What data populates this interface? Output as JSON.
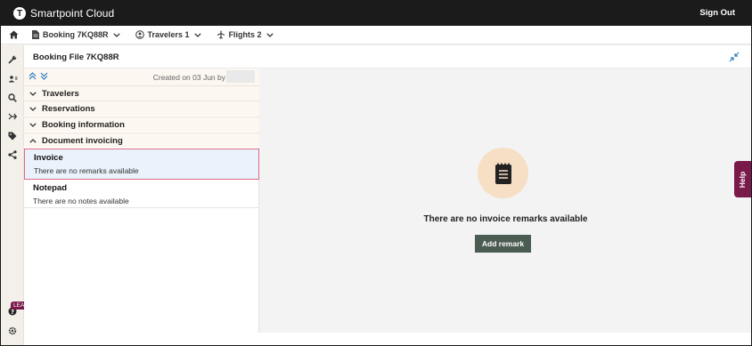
{
  "app": {
    "logo_letter": "T",
    "title": "Smartpoint Cloud",
    "sign_out": "Sign Out"
  },
  "nav": {
    "booking": "Booking 7KQ88R",
    "travelers": "Travelers 1",
    "flights": "Flights 2"
  },
  "sidebar": {
    "learn_badge": "LEARN"
  },
  "header": {
    "title": "Booking File 7KQ88R"
  },
  "left_panel": {
    "created": "Created on 03 Jun by",
    "sections": [
      {
        "label": "Travelers",
        "expanded": false
      },
      {
        "label": "Reservations",
        "expanded": false
      },
      {
        "label": "Booking information",
        "expanded": false
      },
      {
        "label": "Document invoicing",
        "expanded": true
      }
    ],
    "invoice": {
      "title": "Invoice",
      "subtitle": "There are no remarks available"
    },
    "notepad": {
      "title": "Notepad",
      "subtitle": "There are no notes available"
    }
  },
  "main": {
    "empty_message": "There are no invoice remarks available",
    "add_button": "Add remark"
  },
  "help": {
    "label": "Help"
  },
  "colors": {
    "topbar": "#1b1b1b",
    "accent_button": "#4b5c52",
    "help_tab": "#7a1a4b",
    "selected_border": "#e06a85",
    "selected_bg": "#eaf3fb",
    "empty_circle": "#f6dfc4"
  },
  "icons": [
    "home-icon",
    "document-icon",
    "user-icon",
    "plane-icon",
    "chevron-down-icon",
    "wrench-icon",
    "contacts-icon",
    "search-icon",
    "tag-icon",
    "share-icon",
    "help-circle-icon",
    "gear-icon",
    "expand-all-icon",
    "collapse-all-icon",
    "collapse-panel-icon",
    "notepad-icon"
  ]
}
